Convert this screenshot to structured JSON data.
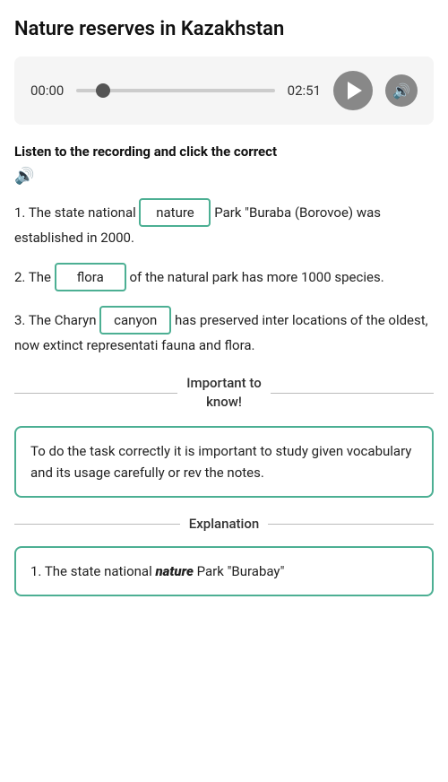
{
  "page": {
    "title": "Nature reserves in Kazakhstan"
  },
  "audio": {
    "time_start": "00:00",
    "time_end": "02:51",
    "play_label": "Play",
    "volume_icon": "🔊"
  },
  "instruction": {
    "text": "Listen to the recording and click the correct",
    "audio_icon": "🔊"
  },
  "questions": [
    {
      "number": "1.",
      "prefix": "The state national",
      "answer": "nature",
      "suffix": "Park \"Buraba (Borovoe) was established in 2000."
    },
    {
      "number": "2.",
      "prefix": "The",
      "answer": "flora",
      "suffix": "of the natural park has more 1000 species."
    },
    {
      "number": "3.",
      "prefix": "The Charyn",
      "answer": "canyon",
      "suffix": "has preserved inter locations of the oldest, now extinct representati fauna and flora."
    }
  ],
  "divider": {
    "label": "Important to\nknow!"
  },
  "info_box": {
    "text": "To do the task correctly it is important to study given vocabulary and its usage carefully or rev the notes."
  },
  "explanation": {
    "label": "Explanation"
  },
  "explanation_box": {
    "prefix": "1. The state national",
    "bold_word": "nature",
    "suffix": "Park \"Burabay\""
  }
}
